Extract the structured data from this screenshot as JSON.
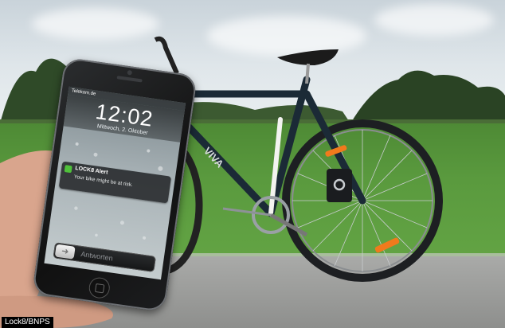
{
  "photo": {
    "credit": "Lock8/BNPS",
    "bicycle_frame_text": "VIVA"
  },
  "phone": {
    "carrier": "Telekom.de",
    "time": "12:02",
    "date": "Mittwoch, 2. Oktober",
    "notification": {
      "app": "LOCK8 Alert",
      "message": "Your bike might be at risk."
    },
    "slider_label": "Antworten",
    "slider_icon": "arrow-right-icon"
  },
  "colors": {
    "alert_icon": "#4fc13b",
    "reflector": "#f07a1c"
  }
}
